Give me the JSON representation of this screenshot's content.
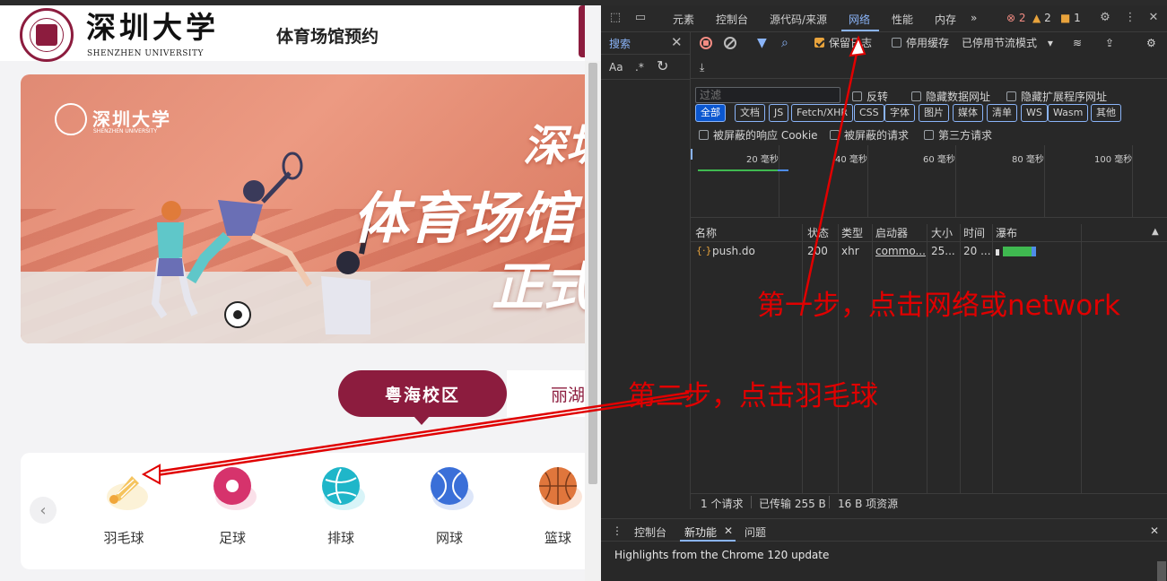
{
  "site": {
    "logo_cn": "深圳大学",
    "logo_en": "SHENZHEN UNIVERSITY",
    "title": "体育场馆预约",
    "banner": {
      "logo_cn": "深圳大学",
      "logo_en": "SHENZHEN UNIVERSITY",
      "text_line1": "深圳",
      "text_line2": "体育场馆",
      "text_line3": "正式"
    },
    "campus_tabs": [
      {
        "label": "粤海校区",
        "active": true
      },
      {
        "label": "丽湖",
        "active": false
      }
    ],
    "sports": [
      {
        "label": "羽毛球",
        "icon": "badminton-icon",
        "color": "#f5c45e",
        "bg": "#f7d98c"
      },
      {
        "label": "足球",
        "icon": "football-icon",
        "color": "#d6336c",
        "bg": "#f2a6c0"
      },
      {
        "label": "排球",
        "icon": "volleyball-icon",
        "color": "#1fb6c9",
        "bg": "#8fe0ea"
      },
      {
        "label": "网球",
        "icon": "tennis-icon",
        "color": "#3a6fd8",
        "bg": "#9db8ef"
      },
      {
        "label": "篮球",
        "icon": "basketball-icon",
        "color": "#e0763c",
        "bg": "#f3b48e"
      }
    ],
    "accent": "#8c1c3e"
  },
  "devtools": {
    "tabs": [
      "元素",
      "控制台",
      "源代码/来源",
      "网络",
      "性能",
      "内存"
    ],
    "active_tab": "网络",
    "more": "»",
    "errors": "2",
    "warnings": "2",
    "issues": "1",
    "search_pane": {
      "title": "搜索",
      "aa": "Aa",
      "regex": ".*"
    },
    "toolbar": {
      "preserve_log": "保留日志",
      "disable_cache": "停用缓存",
      "throttling": "已停用节流模式"
    },
    "filter": {
      "placeholder": "过滤",
      "invert": "反转",
      "hide_data_urls": "隐藏数据网址",
      "hide_ext_urls": "隐藏扩展程序网址",
      "types": [
        "全部",
        "文档",
        "JS",
        "Fetch/XHR",
        "CSS",
        "字体",
        "图片",
        "媒体",
        "清单",
        "WS",
        "Wasm",
        "其他"
      ],
      "blocked_cookies": "被屏蔽的响应 Cookie",
      "blocked_requests": "被屏蔽的请求",
      "third_party": "第三方请求"
    },
    "timeline_labels": [
      "20 毫秒",
      "40 毫秒",
      "60 毫秒",
      "80 毫秒",
      "100 毫秒"
    ],
    "table": {
      "headers": [
        "名称",
        "状态",
        "类型",
        "启动器",
        "大小",
        "时间",
        "瀑布"
      ],
      "rows": [
        {
          "name": "push.do",
          "status": "200",
          "type": "xhr",
          "initiator": "commo...",
          "size": "25...",
          "time": "20 ..."
        }
      ]
    },
    "status": {
      "requests": "1 个请求",
      "transferred": "已传输 255 B",
      "resources": "16 B 项资源"
    },
    "drawer": {
      "tabs": [
        "控制台",
        "新功能",
        "问题"
      ],
      "active": "新功能",
      "highlights": "Highlights from the Chrome 120 update"
    }
  },
  "annotations": {
    "step1": "第一步，点击网络或network",
    "step2": "第二步，点击羽毛球",
    "color": "#e00000"
  }
}
